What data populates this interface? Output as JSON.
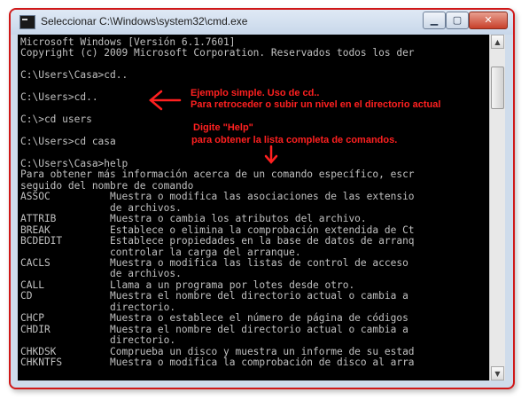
{
  "window": {
    "title": "Seleccionar C:\\Windows\\system32\\cmd.exe",
    "min_label": "▁",
    "max_label": "▢",
    "close_label": "✕"
  },
  "console": {
    "lines": [
      "Microsoft Windows [Versión 6.1.7601]",
      "Copyright (c) 2009 Microsoft Corporation. Reservados todos los der",
      "",
      "C:\\Users\\Casa>cd..",
      "",
      "C:\\Users>cd..",
      "",
      "C:\\>cd users",
      "",
      "C:\\Users>cd casa",
      "",
      "C:\\Users\\Casa>help",
      "Para obtener más información acerca de un comando específico, escr",
      "seguido del nombre de comando",
      "ASSOC          Muestra o modifica las asociaciones de las extensio",
      "               de archivos.",
      "ATTRIB         Muestra o cambia los atributos del archivo.",
      "BREAK          Establece o elimina la comprobación extendida de Ct",
      "BCDEDIT        Establece propiedades en la base de datos de arranq",
      "               controlar la carga del arranque.",
      "CACLS          Muestra o modifica las listas de control de acceso",
      "               de archivos.",
      "CALL           Llama a un programa por lotes desde otro.",
      "CD             Muestra el nombre del directorio actual o cambia a",
      "               directorio.",
      "CHCP           Muestra o establece el número de página de códigos",
      "CHDIR          Muestra el nombre del directorio actual o cambia a",
      "               directorio.",
      "CHKDSK         Comprueba un disco y muestra un informe de su estad",
      "CHKNTFS        Muestra o modifica la comprobación de disco al arra"
    ]
  },
  "annotations": {
    "note1_line1": "Ejemplo simple. Uso de cd..",
    "note1_line2": "Para retroceder o subir un nivel en el directorio actual",
    "note2_line1": "Digite \"Help\"",
    "note2_line2": "para obtener la lista completa de comandos.",
    "color": "#ff2020"
  },
  "scrollbar": {
    "up_icon": "▲",
    "down_icon": "▼"
  }
}
